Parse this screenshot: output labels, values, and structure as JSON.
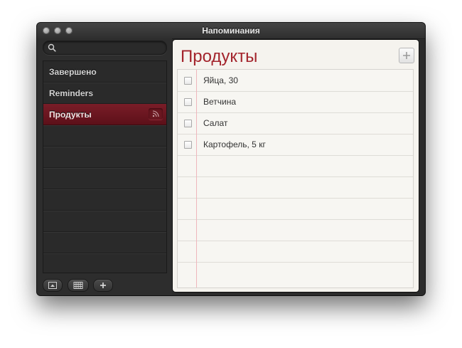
{
  "window": {
    "title": "Напоминания"
  },
  "search": {
    "placeholder": "",
    "value": ""
  },
  "sidebar": {
    "items": [
      {
        "label": "Завершено"
      },
      {
        "label": "Reminders"
      },
      {
        "label": "Продукты",
        "selected": true
      }
    ]
  },
  "main": {
    "title": "Продукты",
    "tasks": [
      {
        "label": "Яйца, 30",
        "done": false
      },
      {
        "label": "Ветчина",
        "done": false
      },
      {
        "label": "Салат",
        "done": false
      },
      {
        "label": "Картофель, 5 кг",
        "done": false
      }
    ]
  },
  "colors": {
    "accent": "#a3242c",
    "selection": "#6b1620",
    "sidebar_bg": "#2b2b2b",
    "paper_bg": "#f5f3ee"
  },
  "icons": {
    "search": "search-icon",
    "share": "share-icon",
    "show_calendar": "calendar-icon",
    "toggle_sidebar": "sidebar-toggle-icon",
    "add_list": "plus-icon",
    "add_task": "plus-icon"
  }
}
